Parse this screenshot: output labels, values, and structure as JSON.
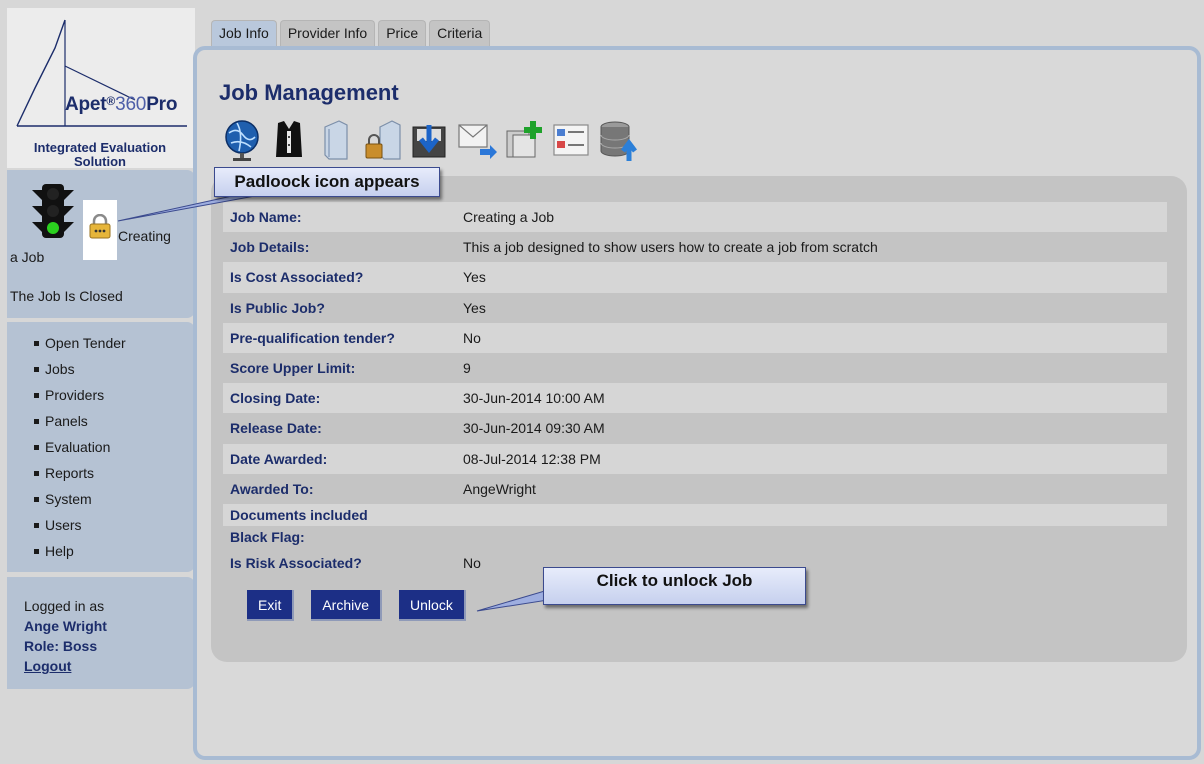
{
  "logo": {
    "brand_main": "Apet",
    "brand_reg": "®",
    "brand_num": "360",
    "brand_pro": "Pro",
    "tagline": "Integrated Evaluation Solution"
  },
  "status": {
    "traffic_light_state": "green",
    "job_name_a": "Creating",
    "job_name_b": "a Job",
    "job_status": "The Job Is Closed"
  },
  "nav": {
    "items": [
      {
        "label": "Open Tender"
      },
      {
        "label": "Jobs"
      },
      {
        "label": "Providers"
      },
      {
        "label": "Panels"
      },
      {
        "label": "Evaluation"
      },
      {
        "label": "Reports"
      },
      {
        "label": "System"
      },
      {
        "label": "Users"
      },
      {
        "label": "Help"
      }
    ]
  },
  "user": {
    "logged_in_label": "Logged in as",
    "name": "Ange Wright",
    "role": "Role: Boss",
    "logout": "Logout"
  },
  "tabs": [
    {
      "label": "Job Info",
      "active": true
    },
    {
      "label": "Provider Info",
      "active": false
    },
    {
      "label": "Price",
      "active": false
    },
    {
      "label": "Criteria",
      "active": false
    }
  ],
  "main": {
    "title": "Job Management",
    "toolbar_icons": [
      "globe-icon",
      "vest-icon",
      "document-icon",
      "padlock-document-icon",
      "inbox-download-icon",
      "mail-forward-icon",
      "add-copy-icon",
      "form-list-icon",
      "database-upload-icon"
    ]
  },
  "fields": [
    {
      "label": "Job Name:",
      "value": "Creating a Job"
    },
    {
      "label": "Job Details:",
      "value": "This a job designed to show users how to create a job from scratch"
    },
    {
      "label": "Is Cost Associated?",
      "value": "Yes"
    },
    {
      "label": "Is Public Job?",
      "value": "Yes"
    },
    {
      "label": "Pre-qualification tender?",
      "value": "No"
    },
    {
      "label": "Score Upper Limit:",
      "value": "9"
    },
    {
      "label": "Closing Date:",
      "value": "30-Jun-2014 10:00 AM"
    },
    {
      "label": "Release Date:",
      "value": "30-Jun-2014 09:30 AM"
    },
    {
      "label": "Date Awarded:",
      "value": "08-Jul-2014 12:38 PM"
    },
    {
      "label": "Awarded To:",
      "value": "AngeWright"
    },
    {
      "label": "Documents included",
      "value": ""
    },
    {
      "label": "Black Flag:",
      "value": ""
    },
    {
      "label": "Is Risk Associated?",
      "value": "No"
    }
  ],
  "buttons": {
    "exit": "Exit",
    "archive": "Archive",
    "unlock": "Unlock"
  },
  "callouts": {
    "padlock": "Padloock icon appears",
    "unlock": "Click to unlock Job"
  },
  "colors": {
    "accent_navy": "#1c2d6b",
    "button_blue": "#1c2f86",
    "sidebar_blue": "#b5c2d3",
    "panel_border": "#a8bbd3"
  }
}
